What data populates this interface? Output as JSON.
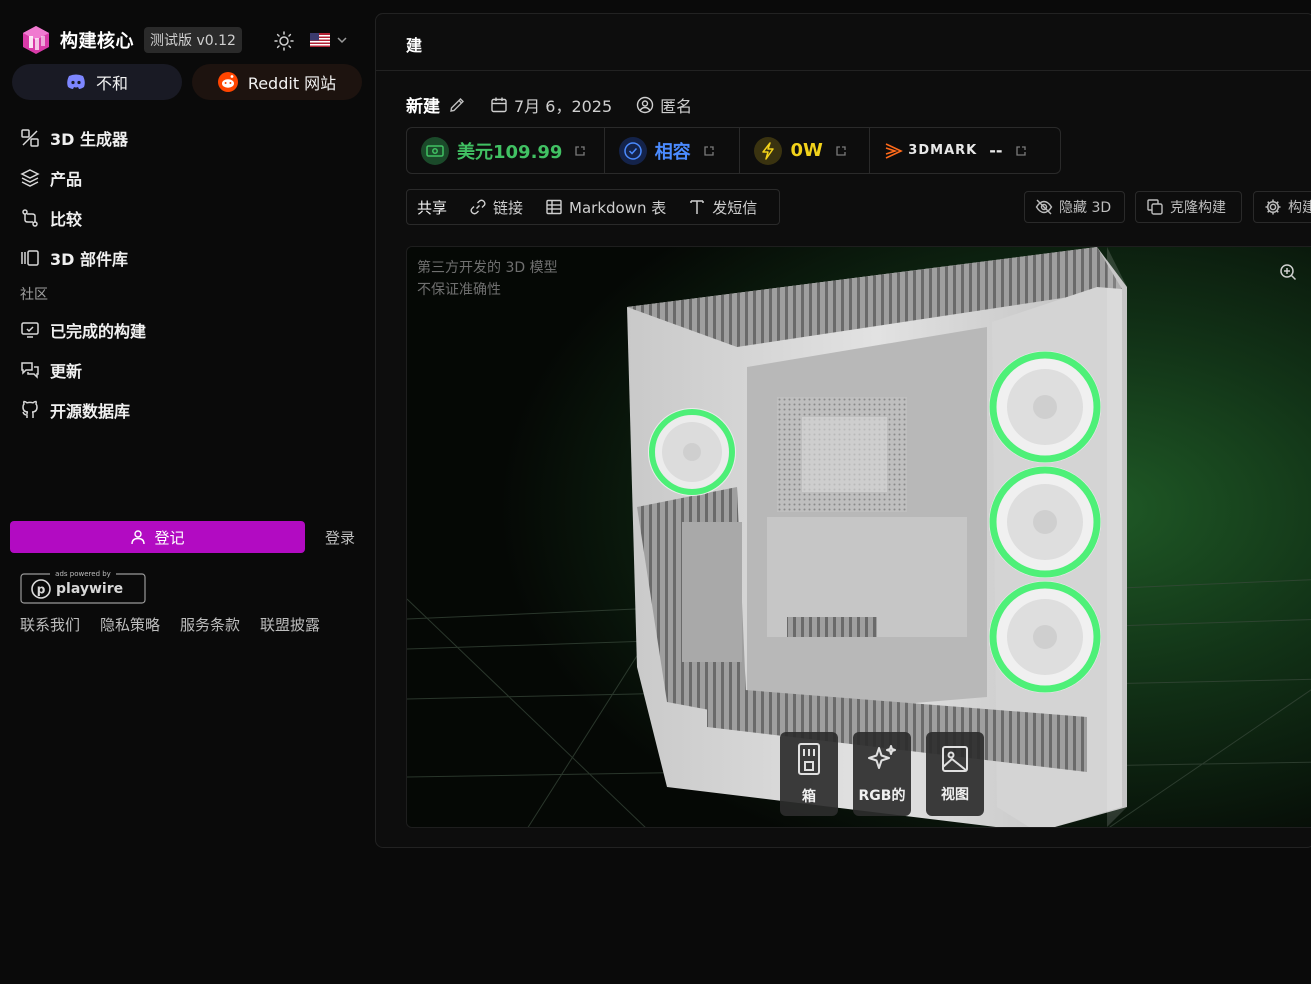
{
  "app": {
    "brand": "构建核心",
    "version_badge": "测试版 v0.12"
  },
  "community_pills": {
    "discord": "不和",
    "reddit": "Reddit 网站"
  },
  "nav": {
    "items": [
      {
        "label": "3D 生成器",
        "icon": "generator-icon"
      },
      {
        "label": "产品",
        "icon": "layers-icon"
      },
      {
        "label": "比较",
        "icon": "compare-icon"
      },
      {
        "label": "3D 部件库",
        "icon": "library-icon"
      }
    ],
    "section": "社区",
    "community_items": [
      {
        "label": "已完成的构建",
        "icon": "monitor-icon"
      },
      {
        "label": "更新",
        "icon": "chat-icon"
      },
      {
        "label": "开源数据库",
        "icon": "github-icon"
      }
    ]
  },
  "auth": {
    "signup": "登记",
    "login": "登录"
  },
  "ads": {
    "powered_by": "ads powered by",
    "brand": "playwire"
  },
  "footer": [
    "联系我们",
    "隐私策略",
    "服务条款",
    "联盟披露"
  ],
  "main": {
    "header_title": "建",
    "build_name": "新建",
    "date": "7月 6，2025",
    "author": "匿名",
    "stats": {
      "price": "美元109.99",
      "compat": "相容",
      "power": "0W",
      "mark_label": "3DMARK",
      "mark_value": "--"
    },
    "toolbar": {
      "share": "共享",
      "link": "链接",
      "markdown": "Markdown 表",
      "text": "发短信"
    },
    "actions": {
      "hide3d": "隐藏 3D",
      "clone": "克隆构建",
      "build": "构建"
    },
    "viewport_note": [
      "第三方开发的 3D 模型",
      "不保证准确性"
    ],
    "dock": [
      {
        "label": "箱",
        "icon": "case-icon"
      },
      {
        "label": "RGB的",
        "icon": "sparkle-icon"
      },
      {
        "label": "视图",
        "icon": "image-icon"
      }
    ]
  },
  "colors": {
    "accent": "#b20bc2",
    "price": "#41c163",
    "compat": "#4b8bff",
    "power": "#f2d21b",
    "rgb": "#3cf06a"
  }
}
